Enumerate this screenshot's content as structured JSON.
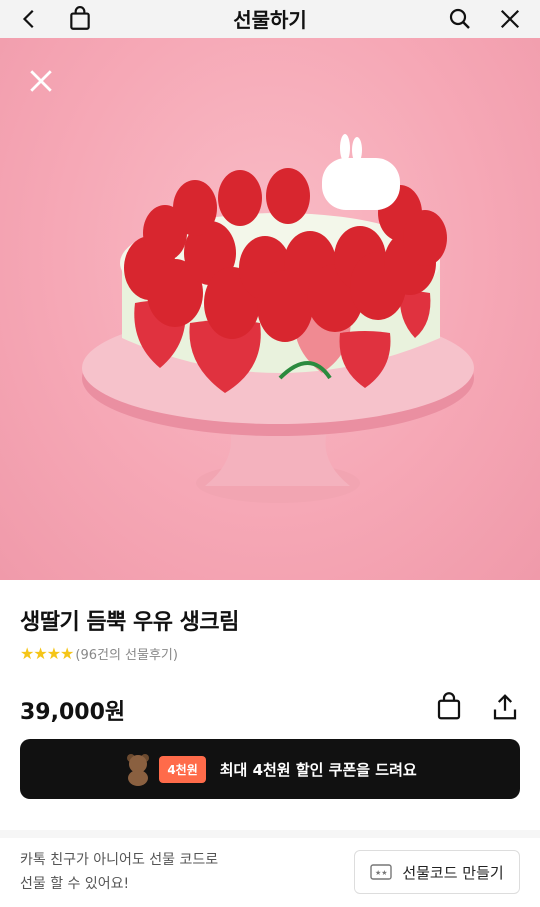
{
  "header": {
    "title": "선물하기",
    "icons": [
      "chevron-left-icon",
      "shopping-bag-icon",
      "search-icon",
      "close-icon"
    ]
  },
  "hero": {
    "close_icon": "close-icon",
    "colors": {
      "background": "#f6a8b6",
      "plate": "#f3b8c3"
    }
  },
  "product": {
    "name": "생딸기 듬뿍 우유 생크림",
    "stars": "★★★★",
    "review_text": "(96건의 선물후기)",
    "price": "39,000원"
  },
  "coupon": {
    "badge": "4천원",
    "text": "최대 4천원 할인 쿠폰을 드려요",
    "colors": {
      "background": "#111111",
      "badge": "#ff6b4a"
    }
  },
  "gift_code": {
    "line1": "카톡 친구가 아니어도 선물 코드로",
    "line2": "선물 할 수 있어요!",
    "button_label": "선물코드 만들기"
  }
}
